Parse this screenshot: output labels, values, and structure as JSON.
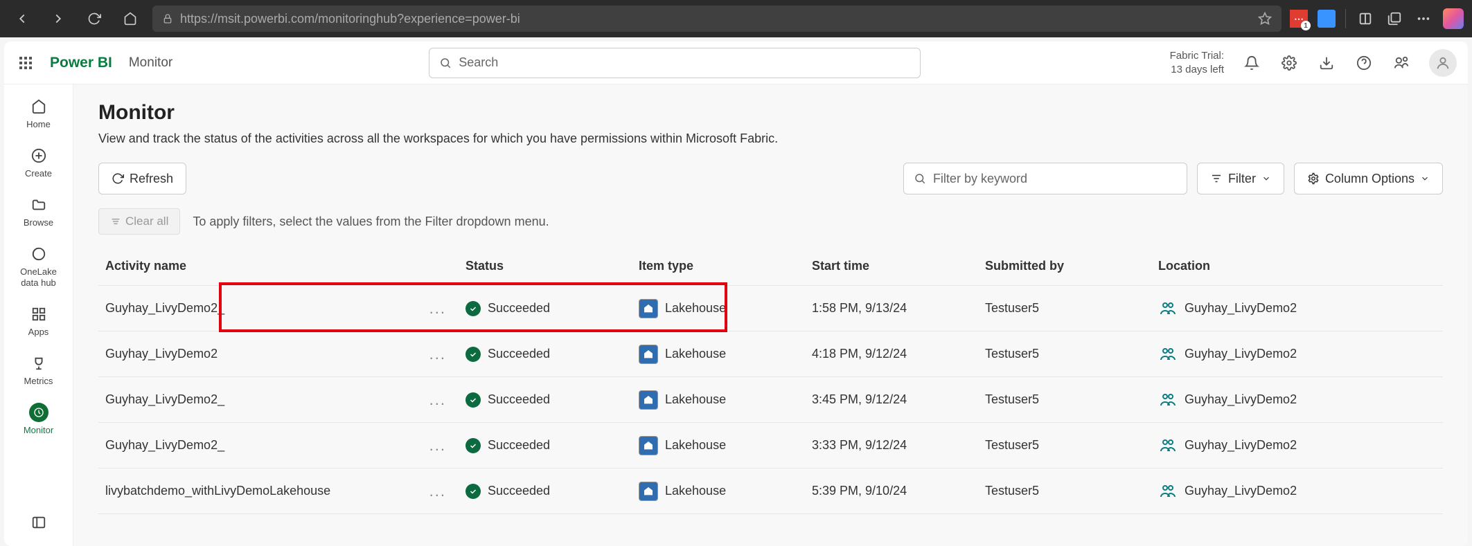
{
  "browser": {
    "url": "https://msit.powerbi.com/monitoringhub?experience=power-bi"
  },
  "header": {
    "brand": "Power BI",
    "breadcrumb": "Monitor",
    "search_placeholder": "Search",
    "trial_line1": "Fabric Trial:",
    "trial_line2": "13 days left"
  },
  "sidebar": {
    "items": [
      {
        "label": "Home"
      },
      {
        "label": "Create"
      },
      {
        "label": "Browse"
      },
      {
        "label": "OneLake data hub"
      },
      {
        "label": "Apps"
      },
      {
        "label": "Metrics"
      },
      {
        "label": "Monitor"
      }
    ]
  },
  "page": {
    "title": "Monitor",
    "subtitle": "View and track the status of the activities across all the workspaces for which you have permissions within Microsoft Fabric."
  },
  "toolbar": {
    "refresh": "Refresh",
    "filter_placeholder": "Filter by keyword",
    "filter_btn": "Filter",
    "columns_btn": "Column Options"
  },
  "filters": {
    "clear": "Clear all",
    "hint": "To apply filters, select the values from the Filter dropdown menu."
  },
  "table": {
    "headers": {
      "activity": "Activity name",
      "status": "Status",
      "item_type": "Item type",
      "start_time": "Start time",
      "submitted_by": "Submitted by",
      "location": "Location"
    },
    "rows": [
      {
        "activity": "Guyhay_LivyDemo2_",
        "status": "Succeeded",
        "item_type": "Lakehouse",
        "start_time": "1:58 PM, 9/13/24",
        "submitted_by": "Testuser5",
        "location": "Guyhay_LivyDemo2",
        "highlight": true
      },
      {
        "activity": "Guyhay_LivyDemo2",
        "status": "Succeeded",
        "item_type": "Lakehouse",
        "start_time": "4:18 PM, 9/12/24",
        "submitted_by": "Testuser5",
        "location": "Guyhay_LivyDemo2"
      },
      {
        "activity": "Guyhay_LivyDemo2_",
        "status": "Succeeded",
        "item_type": "Lakehouse",
        "start_time": "3:45 PM, 9/12/24",
        "submitted_by": "Testuser5",
        "location": "Guyhay_LivyDemo2"
      },
      {
        "activity": "Guyhay_LivyDemo2_",
        "status": "Succeeded",
        "item_type": "Lakehouse",
        "start_time": "3:33 PM, 9/12/24",
        "submitted_by": "Testuser5",
        "location": "Guyhay_LivyDemo2"
      },
      {
        "activity": "livybatchdemo_withLivyDemoLakehouse",
        "status": "Succeeded",
        "item_type": "Lakehouse",
        "start_time": "5:39 PM, 9/10/24",
        "submitted_by": "Testuser5",
        "location": "Guyhay_LivyDemo2"
      }
    ]
  }
}
